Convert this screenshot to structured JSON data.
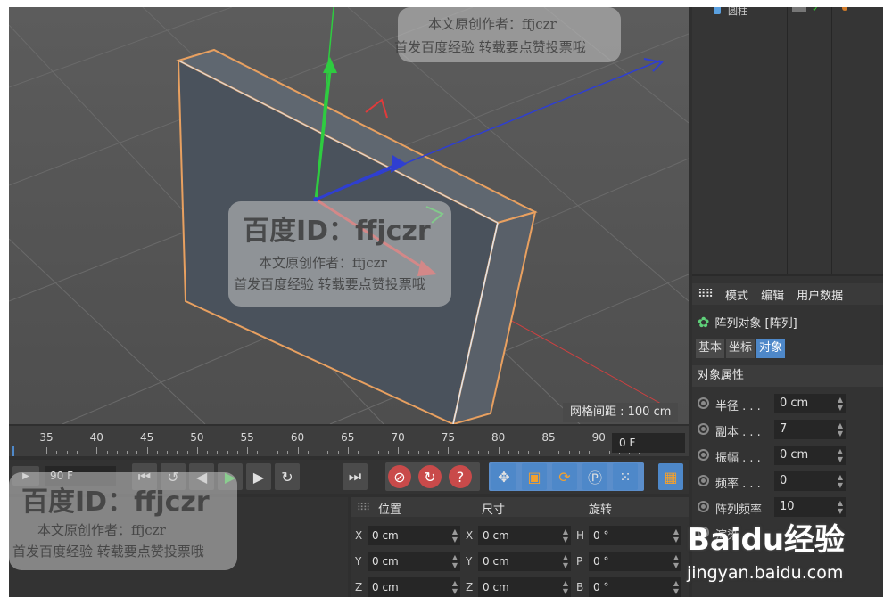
{
  "viewport": {
    "grid_spacing_label": "网格间距 : 100 cm"
  },
  "attributes": {
    "menu": [
      "模式",
      "编辑",
      "用户数据"
    ],
    "object_title": "阵列对象 [阵列]",
    "tabs": [
      "基本",
      "坐标",
      "对象"
    ],
    "active_tab": "对象",
    "section_title": "对象属性",
    "properties": [
      {
        "label": "半径 . . .",
        "value": "0 cm"
      },
      {
        "label": "副本 . . .",
        "value": "7"
      },
      {
        "label": "振幅 . . .",
        "value": "0 cm"
      },
      {
        "label": "频率 . . .",
        "value": "0"
      },
      {
        "label": "阵列频率",
        "value": "10"
      },
      {
        "label": "渲染",
        "value": ""
      }
    ]
  },
  "timeline": {
    "ticks": [
      "35",
      "40",
      "45",
      "50",
      "55",
      "60",
      "65",
      "70",
      "75",
      "80",
      "85",
      "90"
    ],
    "current_frame": "0 F",
    "end_frame": "90 F"
  },
  "coordinates": {
    "headers": [
      "位置",
      "尺寸",
      "旋转"
    ],
    "rows": [
      {
        "pos_axis": "X",
        "pos": "0 cm",
        "size_axis": "X",
        "size": "0 cm",
        "rot_axis": "H",
        "rot": "0 °"
      },
      {
        "pos_axis": "Y",
        "pos": "0 cm",
        "size_axis": "Y",
        "size": "0 cm",
        "rot_axis": "P",
        "rot": "0 °"
      },
      {
        "pos_axis": "Z",
        "pos": "0 cm",
        "size_axis": "Z",
        "size": "0 cm",
        "rot_axis": "B",
        "rot": "0 °"
      }
    ]
  },
  "object_manager": {
    "item_label": "圆柱"
  },
  "watermarks": {
    "id_text": "百度ID：ffjczr",
    "line1": "本文原创作者：ffjczr",
    "line2": "首发百度经验 转载要点赞投票哦",
    "brand": "Baidu经验",
    "url": "jingyan.baidu.com"
  },
  "colors": {
    "accent_blue": "#4e88c9",
    "axis_x": "#e03b3b",
    "axis_y": "#2ecc40",
    "axis_z": "#2f3fd0",
    "selection_outline": "#e8a060"
  }
}
